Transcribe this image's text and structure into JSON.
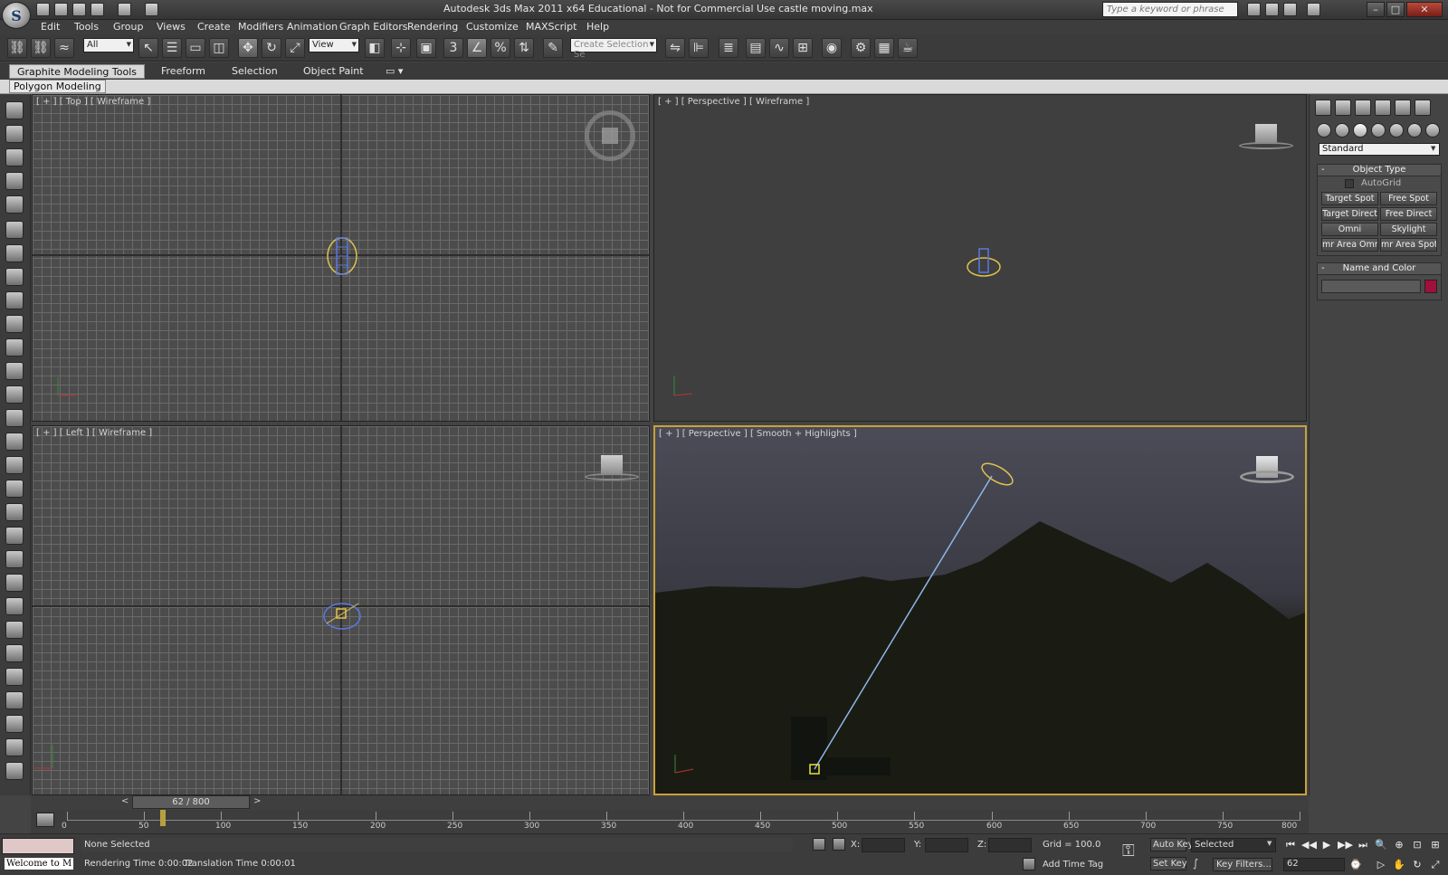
{
  "window": {
    "title": "Autodesk 3ds Max  2011 x64   Educational  - Not for Commercial Use    castle moving.max",
    "search_placeholder": "Type a keyword or phrase",
    "logo_glyph": "S"
  },
  "menu": [
    "Edit",
    "Tools",
    "Group",
    "Views",
    "Create",
    "Modifiers",
    "Animation",
    "Graph Editors",
    "Rendering",
    "Customize",
    "MAXScript",
    "Help"
  ],
  "toolbar": {
    "selection_filter": "All",
    "ref_coord": "View",
    "selection_set": "Create Selection Se",
    "snap_label": "3"
  },
  "ribbon": {
    "tabs": [
      "Graphite Modeling Tools",
      "Freeform",
      "Selection",
      "Object Paint"
    ],
    "active_tab": "Graphite Modeling Tools",
    "panel_label": "Polygon Modeling"
  },
  "viewports": {
    "top_left": "[ + ] [ Top ] [ Wireframe ]",
    "top_right": "[ + ] [ Perspective ] [ Wireframe ]",
    "bottom_left": "[ + ] [ Left ] [ Wireframe ]",
    "bottom_right": "[ + ] [ Perspective ] [ Smooth + Highlights ]"
  },
  "command_panel": {
    "category": "Standard",
    "object_type_title": "Object Type",
    "autogrid_label": "AutoGrid",
    "buttons": [
      "Target Spot",
      "Free Spot",
      "Target Direct",
      "Free Direct",
      "Omni",
      "Skylight",
      "mr Area Omni",
      "mr Area Spot"
    ],
    "name_color_title": "Name and Color",
    "swatch_color": "#a0103c"
  },
  "timeline": {
    "frame_display": "62 / 800",
    "ticks": [
      "0",
      "50",
      "100",
      "150",
      "200",
      "250",
      "300",
      "350",
      "400",
      "450",
      "500",
      "550",
      "600",
      "650",
      "700",
      "750",
      "800"
    ]
  },
  "status": {
    "welcome": "Welcome to M",
    "selection": "None Selected",
    "rendering_time": "Rendering Time  0:00:02",
    "translation_time": "Translation Time  0:00:01",
    "x_label": "X:",
    "y_label": "Y:",
    "z_label": "Z:",
    "grid": "Grid = 100.0",
    "add_time_tag": "Add Time Tag",
    "auto_key": "Auto Key",
    "set_key": "Set Key",
    "key_mode": "Selected",
    "key_filters": "Key Filters...",
    "current_frame": "62"
  }
}
